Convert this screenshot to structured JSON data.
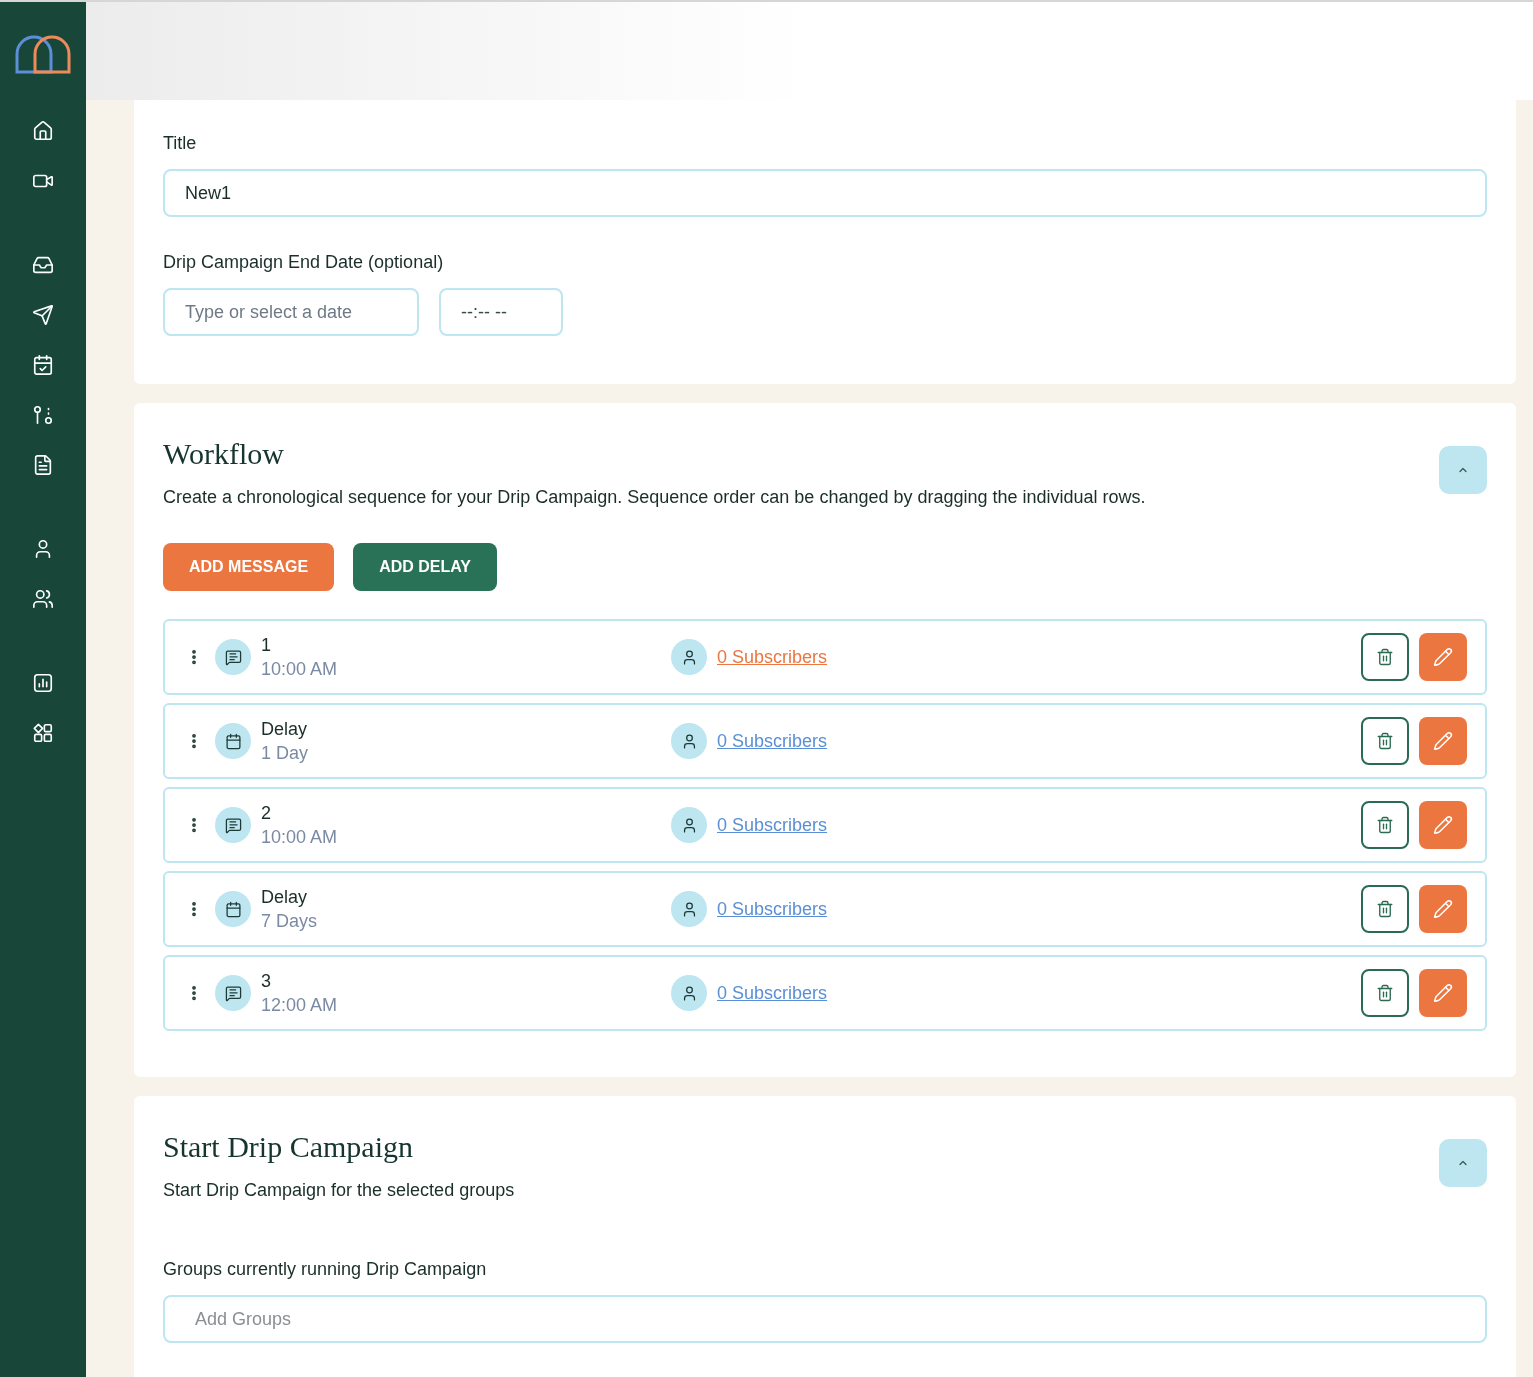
{
  "details": {
    "title_label": "Title",
    "title_value": "New1",
    "end_date_label": "Drip Campaign End Date (optional)",
    "date_placeholder": "Type or select a date",
    "time_placeholder": "--:-- --"
  },
  "workflow": {
    "heading": "Workflow",
    "description": "Create a chronological sequence for your Drip Campaign. Sequence order can be changed by dragging the individual rows.",
    "expanded": true,
    "buttons": [
      {
        "label": "ADD MESSAGE",
        "kind": "primary"
      },
      {
        "label": "ADD DELAY",
        "kind": "secondary"
      }
    ],
    "steps": [
      {
        "kind": "message",
        "title": "1",
        "subtitle": "10:00 AM",
        "subscribers": "0 Subscribers",
        "hovered": true
      },
      {
        "kind": "delay",
        "title": "Delay",
        "subtitle": "1 Day",
        "subscribers": "0 Subscribers",
        "hovered": false
      },
      {
        "kind": "message",
        "title": "2",
        "subtitle": "10:00 AM",
        "subscribers": "0 Subscribers",
        "hovered": false
      },
      {
        "kind": "delay",
        "title": "Delay",
        "subtitle": "7 Days",
        "subscribers": "0 Subscribers",
        "hovered": false
      },
      {
        "kind": "message",
        "title": "3",
        "subtitle": "12:00 AM",
        "subscribers": "0 Subscribers",
        "hovered": false
      }
    ]
  },
  "start": {
    "heading": "Start Drip Campaign",
    "description": "Start Drip Campaign for the selected groups",
    "expanded": true,
    "groups_label": "Groups currently running Drip Campaign",
    "groups_placeholder": "Add Groups"
  }
}
